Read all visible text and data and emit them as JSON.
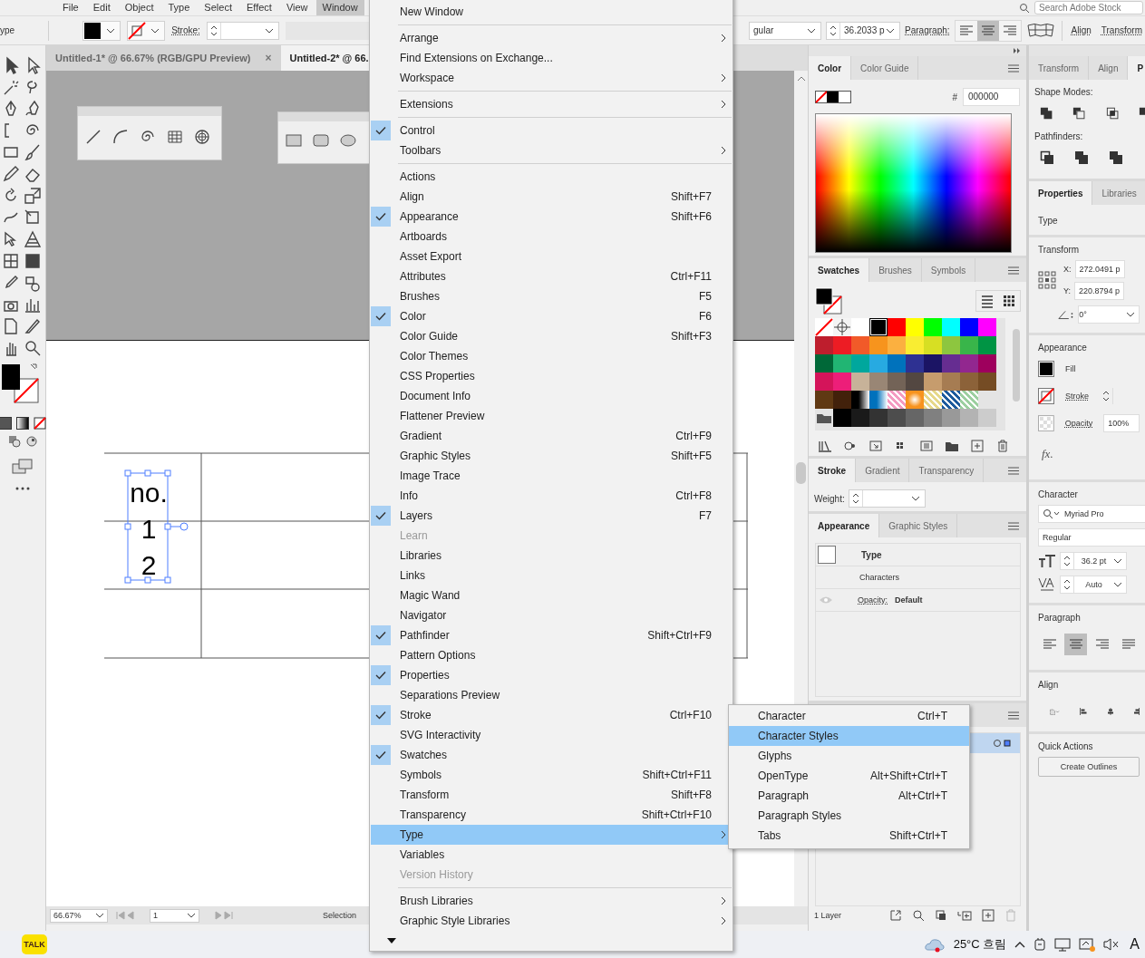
{
  "menubar": {
    "items": [
      {
        "label": "File",
        "selected": false
      },
      {
        "label": "Edit",
        "selected": false
      },
      {
        "label": "Object",
        "selected": false
      },
      {
        "label": "Type",
        "selected": false
      },
      {
        "label": "Select",
        "selected": false
      },
      {
        "label": "Effect",
        "selected": false
      },
      {
        "label": "View",
        "selected": false
      },
      {
        "label": "Window",
        "selected": true
      }
    ],
    "search": {
      "placeholder": "Search Adobe Stock"
    }
  },
  "control_bar": {
    "mode_label": "ype",
    "stroke_label": "Stroke:",
    "font_style": "gular",
    "font_size": "36.2033 p",
    "paragraph_label": "Paragraph:",
    "align_buttons": [
      {
        "selected": false
      },
      {
        "selected": true
      },
      {
        "selected": false
      }
    ],
    "links": [
      "Align",
      "Transform"
    ]
  },
  "document_tabs": [
    {
      "title": "Untitled-1* @ 66.67% (RGB/GPU Preview)",
      "close": "×",
      "selected": false
    },
    {
      "title": "Untitled-2* @ 66.",
      "selected": true
    }
  ],
  "canvas": {
    "text_lines": [
      "no.",
      "1",
      "2"
    ]
  },
  "status_bar": {
    "zoom": "66.67%",
    "artboard": "1",
    "tool": "Selection"
  },
  "window_menu": {
    "groups": [
      {
        "items": [
          {
            "label": "New Window",
            "checked": false,
            "disabled": false,
            "selected": false,
            "has_submenu": false
          }
        ]
      },
      {
        "items": [
          {
            "label": "Arrange",
            "checked": false,
            "disabled": false,
            "selected": false,
            "has_submenu": true
          },
          {
            "label": "Find Extensions on Exchange...",
            "checked": false,
            "disabled": false,
            "selected": false,
            "has_submenu": false
          },
          {
            "label": "Workspace",
            "checked": false,
            "disabled": false,
            "selected": false,
            "has_submenu": true
          }
        ]
      },
      {
        "items": [
          {
            "label": "Extensions",
            "checked": false,
            "disabled": false,
            "selected": false,
            "has_submenu": true
          }
        ]
      },
      {
        "items": [
          {
            "label": "Control",
            "checked": true,
            "disabled": false,
            "selected": false,
            "has_submenu": false
          },
          {
            "label": "Toolbars",
            "checked": false,
            "disabled": false,
            "selected": false,
            "has_submenu": true
          }
        ]
      },
      {
        "items": [
          {
            "label": "Actions",
            "checked": false,
            "disabled": false,
            "selected": false,
            "has_submenu": false
          },
          {
            "label": "Align",
            "shortcut": "Shift+F7",
            "checked": false,
            "disabled": false,
            "selected": false,
            "has_submenu": false
          },
          {
            "label": "Appearance",
            "shortcut": "Shift+F6",
            "checked": true,
            "disabled": false,
            "selected": false,
            "has_submenu": false
          },
          {
            "label": "Artboards",
            "checked": false,
            "disabled": false,
            "selected": false,
            "has_submenu": false
          },
          {
            "label": "Asset Export",
            "checked": false,
            "disabled": false,
            "selected": false,
            "has_submenu": false
          },
          {
            "label": "Attributes",
            "shortcut": "Ctrl+F11",
            "checked": false,
            "disabled": false,
            "selected": false,
            "has_submenu": false
          },
          {
            "label": "Brushes",
            "shortcut": "F5",
            "checked": false,
            "disabled": false,
            "selected": false,
            "has_submenu": false
          },
          {
            "label": "Color",
            "shortcut": "F6",
            "checked": true,
            "disabled": false,
            "selected": false,
            "has_submenu": false
          },
          {
            "label": "Color Guide",
            "shortcut": "Shift+F3",
            "checked": false,
            "disabled": false,
            "selected": false,
            "has_submenu": false
          },
          {
            "label": "Color Themes",
            "checked": false,
            "disabled": false,
            "selected": false,
            "has_submenu": false
          },
          {
            "label": "CSS Properties",
            "checked": false,
            "disabled": false,
            "selected": false,
            "has_submenu": false
          },
          {
            "label": "Document Info",
            "checked": false,
            "disabled": false,
            "selected": false,
            "has_submenu": false
          },
          {
            "label": "Flattener Preview",
            "checked": false,
            "disabled": false,
            "selected": false,
            "has_submenu": false
          },
          {
            "label": "Gradient",
            "shortcut": "Ctrl+F9",
            "checked": false,
            "disabled": false,
            "selected": false,
            "has_submenu": false
          },
          {
            "label": "Graphic Styles",
            "shortcut": "Shift+F5",
            "checked": false,
            "disabled": false,
            "selected": false,
            "has_submenu": false
          },
          {
            "label": "Image Trace",
            "checked": false,
            "disabled": false,
            "selected": false,
            "has_submenu": false
          },
          {
            "label": "Info",
            "shortcut": "Ctrl+F8",
            "checked": false,
            "disabled": false,
            "selected": false,
            "has_submenu": false
          },
          {
            "label": "Layers",
            "shortcut": "F7",
            "checked": true,
            "disabled": false,
            "selected": false,
            "has_submenu": false
          },
          {
            "label": "Learn",
            "checked": false,
            "disabled": true,
            "selected": false,
            "has_submenu": false
          },
          {
            "label": "Libraries",
            "checked": false,
            "disabled": false,
            "selected": false,
            "has_submenu": false
          },
          {
            "label": "Links",
            "checked": false,
            "disabled": false,
            "selected": false,
            "has_submenu": false
          },
          {
            "label": "Magic Wand",
            "checked": false,
            "disabled": false,
            "selected": false,
            "has_submenu": false
          },
          {
            "label": "Navigator",
            "checked": false,
            "disabled": false,
            "selected": false,
            "has_submenu": false
          },
          {
            "label": "Pathfinder",
            "shortcut": "Shift+Ctrl+F9",
            "checked": true,
            "disabled": false,
            "selected": false,
            "has_submenu": false
          },
          {
            "label": "Pattern Options",
            "checked": false,
            "disabled": false,
            "selected": false,
            "has_submenu": false
          },
          {
            "label": "Properties",
            "checked": true,
            "disabled": false,
            "selected": false,
            "has_submenu": false
          },
          {
            "label": "Separations Preview",
            "checked": false,
            "disabled": false,
            "selected": false,
            "has_submenu": false
          },
          {
            "label": "Stroke",
            "shortcut": "Ctrl+F10",
            "checked": true,
            "disabled": false,
            "selected": false,
            "has_submenu": false
          },
          {
            "label": "SVG Interactivity",
            "checked": false,
            "disabled": false,
            "selected": false,
            "has_submenu": false
          },
          {
            "label": "Swatches",
            "checked": true,
            "disabled": false,
            "selected": false,
            "has_submenu": false
          },
          {
            "label": "Symbols",
            "shortcut": "Shift+Ctrl+F11",
            "checked": false,
            "disabled": false,
            "selected": false,
            "has_submenu": false
          },
          {
            "label": "Transform",
            "shortcut": "Shift+F8",
            "checked": false,
            "disabled": false,
            "selected": false,
            "has_submenu": false
          },
          {
            "label": "Transparency",
            "shortcut": "Shift+Ctrl+F10",
            "checked": false,
            "disabled": false,
            "selected": false,
            "has_submenu": false
          },
          {
            "label": "Type",
            "checked": false,
            "disabled": false,
            "selected": true,
            "has_submenu": true
          },
          {
            "label": "Variables",
            "checked": false,
            "disabled": false,
            "selected": false,
            "has_submenu": false
          },
          {
            "label": "Version History",
            "checked": false,
            "disabled": true,
            "selected": false,
            "has_submenu": false
          }
        ]
      },
      {
        "items": [
          {
            "label": "Brush Libraries",
            "checked": false,
            "disabled": false,
            "selected": false,
            "has_submenu": true
          },
          {
            "label": "Graphic Style Libraries",
            "checked": false,
            "disabled": false,
            "selected": false,
            "has_submenu": true
          }
        ]
      }
    ]
  },
  "type_submenu": {
    "items": [
      {
        "label": "Character",
        "shortcut": "Ctrl+T",
        "selected": false
      },
      {
        "label": "Character Styles",
        "selected": true
      },
      {
        "label": "Glyphs",
        "selected": false
      },
      {
        "label": "OpenType",
        "shortcut": "Alt+Shift+Ctrl+T",
        "selected": false
      },
      {
        "label": "Paragraph",
        "shortcut": "Alt+Ctrl+T",
        "selected": false
      },
      {
        "label": "Paragraph Styles",
        "selected": false
      },
      {
        "label": "Tabs",
        "shortcut": "Shift+Ctrl+T",
        "selected": false
      }
    ]
  },
  "color_panel": {
    "tabs": [
      {
        "label": "Color",
        "selected": true
      },
      {
        "label": "Color Guide",
        "selected": false
      }
    ],
    "hex_label": "#",
    "hex": "000000"
  },
  "swatches_panel": {
    "tabs": [
      {
        "label": "Swatches",
        "selected": true
      },
      {
        "label": "Brushes",
        "selected": false
      },
      {
        "label": "Symbols",
        "selected": false
      }
    ],
    "rows": [
      {
        "cells": [
          {
            "kind": "none",
            "selected": false
          },
          {
            "kind": "registration",
            "selected": false
          },
          {
            "kind": "color",
            "color": "#ffffff",
            "selected": false
          },
          {
            "kind": "color",
            "color": "#000000",
            "selected": true
          },
          {
            "kind": "color",
            "color": "#ff0000",
            "selected": false
          },
          {
            "kind": "color",
            "color": "#ffff00",
            "selected": false
          },
          {
            "kind": "color",
            "color": "#00ff00",
            "selected": false
          },
          {
            "kind": "color",
            "color": "#00ffff",
            "selected": false
          },
          {
            "kind": "color",
            "color": "#0000ff",
            "selected": false
          },
          {
            "kind": "color",
            "color": "#ff00ff",
            "selected": false
          }
        ]
      },
      {
        "cells": [
          {
            "kind": "color",
            "color": "#be1e2d",
            "selected": false
          },
          {
            "kind": "color",
            "color": "#ed1c24",
            "selected": false
          },
          {
            "kind": "color",
            "color": "#f15a29",
            "selected": false
          },
          {
            "kind": "color",
            "color": "#f7941d",
            "selected": false
          },
          {
            "kind": "color",
            "color": "#fbb040",
            "selected": false
          },
          {
            "kind": "color",
            "color": "#f9ed32",
            "selected": false
          },
          {
            "kind": "color",
            "color": "#d7df23",
            "selected": false
          },
          {
            "kind": "color",
            "color": "#8dc63f",
            "selected": false
          },
          {
            "kind": "color",
            "color": "#39b54a",
            "selected": false
          },
          {
            "kind": "color",
            "color": "#009444",
            "selected": false
          }
        ]
      },
      {
        "cells": [
          {
            "kind": "color",
            "color": "#006838",
            "selected": false
          },
          {
            "kind": "color",
            "color": "#21b573",
            "selected": false
          },
          {
            "kind": "color",
            "color": "#00a79d",
            "selected": false
          },
          {
            "kind": "color",
            "color": "#27aae1",
            "selected": false
          },
          {
            "kind": "color",
            "color": "#0072bc",
            "selected": false
          },
          {
            "kind": "color",
            "color": "#2e3192",
            "selected": false
          },
          {
            "kind": "color",
            "color": "#1b1464",
            "selected": false
          },
          {
            "kind": "color",
            "color": "#662d91",
            "selected": false
          },
          {
            "kind": "color",
            "color": "#92278f",
            "selected": false
          },
          {
            "kind": "color",
            "color": "#9e005d",
            "selected": false
          }
        ]
      },
      {
        "cells": [
          {
            "kind": "color",
            "color": "#d4145a",
            "selected": false
          },
          {
            "kind": "color",
            "color": "#ed1e79",
            "selected": false
          },
          {
            "kind": "color",
            "color": "#c7b299",
            "selected": false
          },
          {
            "kind": "color",
            "color": "#998675",
            "selected": false
          },
          {
            "kind": "color",
            "color": "#736357",
            "selected": false
          },
          {
            "kind": "color",
            "color": "#534741",
            "selected": false
          },
          {
            "kind": "color",
            "color": "#c69c6d",
            "selected": false
          },
          {
            "kind": "color",
            "color": "#a67c52",
            "selected": false
          },
          {
            "kind": "color",
            "color": "#8c6239",
            "selected": false
          },
          {
            "kind": "color",
            "color": "#754c24",
            "selected": false
          }
        ]
      },
      {
        "cells": [
          {
            "kind": "color",
            "color": "#603913",
            "selected": false
          },
          {
            "kind": "color",
            "color": "#42210b",
            "selected": false
          },
          {
            "kind": "gradient",
            "color": "#000000",
            "selected": false
          },
          {
            "kind": "gradient",
            "color": "#0071bc",
            "selected": false
          },
          {
            "kind": "pattern",
            "color": "#f49ac1",
            "selected": false
          },
          {
            "kind": "radial",
            "color": "#f7931e",
            "selected": false
          },
          {
            "kind": "pattern",
            "color": "#e6d88a",
            "selected": false
          },
          {
            "kind": "pattern",
            "color": "#1c5a9c",
            "selected": false
          },
          {
            "kind": "pattern",
            "color": "#9ccfa0",
            "selected": false
          }
        ]
      },
      {
        "cells": [
          {
            "kind": "folder",
            "selected": false
          },
          {
            "kind": "color",
            "color": "#000000",
            "selected": false
          },
          {
            "kind": "color",
            "color": "#1a1a1a",
            "selected": false
          },
          {
            "kind": "color",
            "color": "#333333",
            "selected": false
          },
          {
            "kind": "color",
            "color": "#4d4d4d",
            "selected": false
          },
          {
            "kind": "color",
            "color": "#666666",
            "selected": false
          },
          {
            "kind": "color",
            "color": "#808080",
            "selected": false
          },
          {
            "kind": "color",
            "color": "#999999",
            "selected": false
          },
          {
            "kind": "color",
            "color": "#b3b3b3",
            "selected": false
          },
          {
            "kind": "color",
            "color": "#cccccc",
            "selected": false
          }
        ]
      }
    ]
  },
  "stroke_panel": {
    "tabs": [
      {
        "label": "Stroke",
        "selected": true
      },
      {
        "label": "Gradient",
        "selected": false
      },
      {
        "label": "Transparency",
        "selected": false
      }
    ],
    "weight_label": "Weight:"
  },
  "appearance_panel": {
    "tabs": [
      {
        "label": "Appearance",
        "selected": true
      },
      {
        "label": "Graphic Styles",
        "selected": false
      }
    ],
    "object_label": "Type",
    "characters_label": "Characters",
    "opacity_label": "Opacity:",
    "opacity_value": "Default"
  },
  "layers_panel": {
    "footer": "1 Layer"
  },
  "pathfinder_panel": {
    "tabs": [
      {
        "label": "Transform",
        "selected": false
      },
      {
        "label": "Align",
        "selected": false
      },
      {
        "label": "P",
        "selected": true
      }
    ],
    "shape_modes_label": "Shape Modes:",
    "pathfinders_label": "Pathfinders:"
  },
  "properties_panel": {
    "tabs": [
      {
        "label": "Properties",
        "selected": true
      },
      {
        "label": "Libraries",
        "selected": false
      }
    ],
    "object_type": "Type",
    "transform": {
      "title": "Transform",
      "x_label": "X:",
      "x": "272.0491 p",
      "y_label": "Y:",
      "y": "220.8794 p",
      "angle": "0°"
    },
    "appearance": {
      "title": "Appearance",
      "fill": "Fill",
      "stroke": "Stroke",
      "opacity_label": "Opacity",
      "opacity": "100%",
      "fx": "fx."
    },
    "character": {
      "title": "Character",
      "font": "Myriad Pro",
      "style": "Regular",
      "size": "36.2 pt",
      "tracking": "Auto"
    },
    "paragraph": {
      "title": "Paragraph",
      "align_buttons": [
        {
          "selected": false
        },
        {
          "selected": true
        },
        {
          "selected": false
        },
        {
          "selected": false
        }
      ]
    },
    "align": {
      "title": "Align"
    },
    "quick_actions": {
      "title": "Quick Actions",
      "button": "Create Outlines"
    }
  },
  "taskbar": {
    "app_icon_label": "TALK",
    "weather": "25°C 흐림",
    "ime": "A"
  }
}
